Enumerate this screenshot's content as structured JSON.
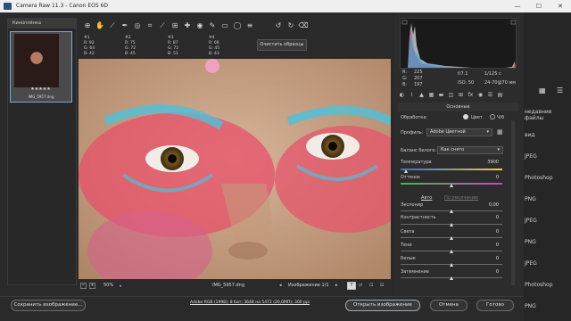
{
  "title": "Camera Raw 11.3  -  Canon EOS 6D",
  "window_controls": {
    "minimize": "—",
    "maximize": "☐",
    "close": "✕"
  },
  "filmstrip": {
    "header": "Киноплёнка",
    "thumb_stars": "★★★★★",
    "thumb_name": "IMG_5957.dng"
  },
  "toolbar": {
    "tools": [
      "zoom-icon",
      "hand-icon",
      "white-balance-icon",
      "color-sampler-icon",
      "targeted-adjust-icon",
      "crop-icon",
      "straighten-icon",
      "transform-icon",
      "spot-removal-icon",
      "red-eye-icon",
      "adjustment-brush-icon",
      "graduated-filter-icon",
      "radial-filter-icon",
      "preferences-icon",
      "rotate-left-icon",
      "rotate-right-icon",
      "trash-icon"
    ],
    "glyphs": [
      "🔍",
      "✋",
      "⟋",
      "⊕",
      "◎",
      "⌗",
      "⟋",
      "⊞",
      "✚",
      "◉",
      "✎",
      "▭",
      "◯",
      "≡",
      "↺",
      "↻",
      "🗑"
    ]
  },
  "samplers": [
    {
      "id": "#1",
      "r": "R: 92",
      "g": "G: 64",
      "b": "B: 42"
    },
    {
      "id": "#2",
      "r": "R: 75",
      "g": "G: 72",
      "b": "B: 45"
    },
    {
      "id": "#3",
      "r": "R: 87",
      "g": "G: 72",
      "b": "B: 51"
    },
    {
      "id": "#4",
      "r": "R: 66",
      "g": "G: 45",
      "b": "B: 43"
    }
  ],
  "clear_samplers": "Очистить образцы",
  "zoom_level": "50%",
  "filename": "IMG_5957.dng",
  "image_counter": "Изображение 1/1",
  "readout": {
    "r": "R:",
    "g": "G:",
    "b": "B:",
    "r_val": "225",
    "g_val": "207",
    "b_val": "197",
    "aperture": "f/7.1",
    "shutter": "1/125 с",
    "iso": "ISO: 50",
    "lens": "24-70@70 мм"
  },
  "panel": {
    "title": "Основные",
    "processing_label": "Обработка:",
    "color_option": "Цвет",
    "bw_option": "Ч/б",
    "profile_label": "Профиль:",
    "profile_value": "Adobe Цветной",
    "wb_label": "Баланс белого:",
    "wb_value": "Как снято",
    "temperature_label": "Температура",
    "temperature_value": "3900",
    "tint_label": "Оттенок",
    "tint_value": "0",
    "auto_link": "Авто",
    "default_link": "По умолчанию",
    "sliders": [
      {
        "label": "Экспонир",
        "value": "0,00",
        "pos": 0.5
      },
      {
        "label": "Контрастность",
        "value": "0",
        "pos": 0.5
      },
      {
        "label": "Света",
        "value": "0",
        "pos": 0.5
      },
      {
        "label": "Тени",
        "value": "0",
        "pos": 0.5
      },
      {
        "label": "Белые",
        "value": "0",
        "pos": 0.5
      },
      {
        "label": "Затемнение",
        "value": "0",
        "pos": 0.5
      }
    ]
  },
  "bottom": {
    "save": "Сохранить изображение...",
    "workflow": "Adobe RGB (1998); 8 бит; 3648 на 5472 (20,0МП); 300 ppi",
    "open": "Открыть изображение",
    "cancel": "Отмена",
    "done": "Готово"
  },
  "background_window": {
    "labels": [
      "недавние файлы",
      "вид",
      "JPEG",
      "Photoshop",
      "PNG",
      "JPEG",
      "PNG",
      "JPEG",
      "Photoshop",
      "PNG"
    ]
  }
}
